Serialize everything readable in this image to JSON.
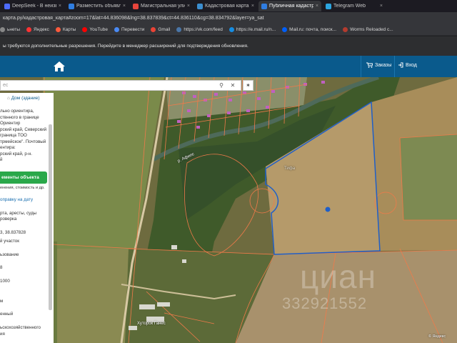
{
  "tabs": [
    {
      "label": "DeepSeek - В неизвестн",
      "color": "#4d6bfe"
    },
    {
      "label": "Разместить объявление о",
      "color": "#2f7de1"
    },
    {
      "label": "Магистральная улица — ",
      "color": "#e8453c"
    },
    {
      "label": "Кадастровая карта: Крас",
      "color": "#3b8ed0"
    },
    {
      "label": "Публичная кадастровая",
      "color": "#2f7de1"
    },
    {
      "label": "Telegram Web",
      "color": "#2ca5e0"
    }
  ],
  "address": "карта.ру/кадастровая_карта#zoom=17&lat=44.836098&lng=38.837839&ct=44.836110&cg=38.834792&layer=ya_sat",
  "bookmarks": [
    {
      "label": "ьнеты",
      "color": "#888888"
    },
    {
      "label": "Яндекс",
      "color": "#ff3333"
    },
    {
      "label": "Карты",
      "color": "#ff5a3c"
    },
    {
      "label": "YouTube",
      "color": "#ff0000"
    },
    {
      "label": "Перевести",
      "color": "#4a8af4"
    },
    {
      "label": "Gmail",
      "color": "#ea4335"
    },
    {
      "label": "https://vk.com/feed",
      "color": "#4a76a8"
    },
    {
      "label": "https://e.mail.ru/n...",
      "color": "#168de2"
    },
    {
      "label": "Mail.ru: почта, поиск...",
      "color": "#005ff9"
    },
    {
      "label": "Worms Reloaded c...",
      "color": "#b33b2e"
    }
  ],
  "infobar": "ы требуются дополнительные разрешения. Перейдите в менеджер расширений для подтверждения обновления.",
  "header": {
    "orders_label": "Заказы",
    "login_label": "Вход"
  },
  "search": {
    "placeholder": "ес"
  },
  "panel": {
    "tab_label": "Дом (здание)",
    "lines": [
      "льно ориентира,",
      "ствнного в границе",
      "Ориентир",
      "рский край, Северский",
      "граница ТОО",
      "трмейское\". Почтовый",
      "ентира:",
      "рский край, р-н.",
      "й"
    ],
    "green_button": "ементы объекта",
    "green_sub": "енения, стоимость и др.",
    "link1": "оправку на дату",
    "lines2": [
      "рта, аресты, суды",
      "роверка"
    ],
    "coords": "3, 38.837828",
    "lines3": [
      "й участок",
      "",
      "ьзование",
      "",
      "8",
      "",
      "1000",
      "",
      "",
      "м",
      "",
      "енный",
      "",
      "ьскохозяйственного",
      "ия"
    ]
  },
  "map_labels": {
    "river": "р. Афипс",
    "field": "Тифа",
    "village": "Хуторок Ганес",
    "yandex": "© Яндекс"
  },
  "watermark": {
    "brand": "циан",
    "number": "332921552"
  }
}
